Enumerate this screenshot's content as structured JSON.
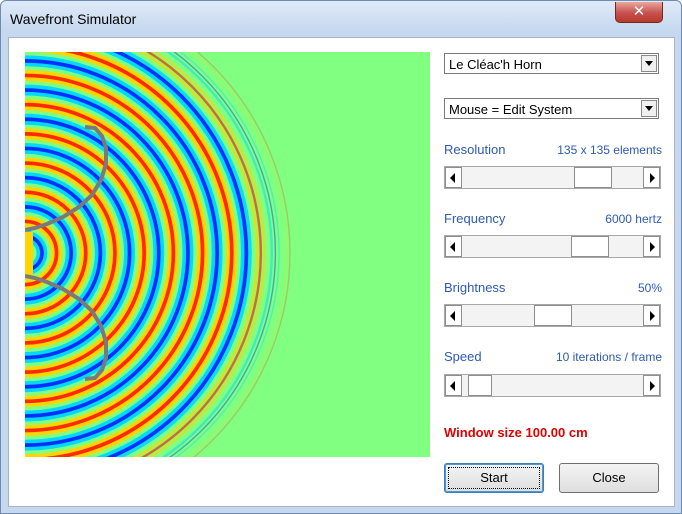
{
  "window": {
    "title": "Wavefront Simulator",
    "close_glyph": "✕"
  },
  "system_select": {
    "value": "Le Cléac'h Horn"
  },
  "mouse_select": {
    "value": "Mouse = Edit System"
  },
  "resolution": {
    "label": "Resolution",
    "value_text": "135 x 135 elements",
    "fraction": 0.78
  },
  "frequency": {
    "label": "Frequency",
    "value_text": "6000 hertz",
    "fraction": 0.76
  },
  "brightness": {
    "label": "Brightness",
    "value_text": "50%",
    "fraction": 0.5
  },
  "speed": {
    "label": "Speed",
    "value_text": "10 iterations / frame",
    "fraction": 0.04
  },
  "status": {
    "window_size": "Window size 100.00 cm"
  },
  "buttons": {
    "start": "Start",
    "close": "Close"
  },
  "colors": {
    "background_field": "#80ff80",
    "label_blue": "#2d5ab4",
    "status_red": "#e00000",
    "horn_wall": "#7a7a7a"
  },
  "icons": {
    "dropdown": "chevron-down-icon",
    "scroll_left": "arrow-left-icon",
    "scroll_right": "arrow-right-icon"
  }
}
